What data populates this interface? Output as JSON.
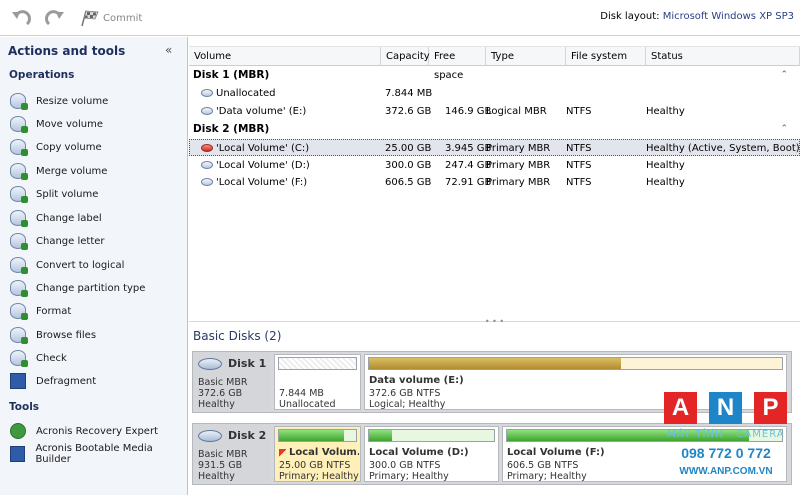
{
  "toolbar": {
    "commit_label": "Commit",
    "disk_layout_label": "Disk layout:",
    "disk_layout_value": "Microsoft Windows XP SP3"
  },
  "sidebar": {
    "title": "Actions and tools",
    "operations_heading": "Operations",
    "operations": [
      "Resize volume",
      "Move volume",
      "Copy volume",
      "Merge volume",
      "Split volume",
      "Change label",
      "Change letter",
      "Convert to logical",
      "Change partition type",
      "Format",
      "Browse files",
      "Check",
      "Defragment"
    ],
    "tools_heading": "Tools",
    "tools": [
      "Acronis Recovery Expert",
      "Acronis Bootable Media Builder"
    ]
  },
  "grid": {
    "columns": [
      "Volume",
      "Capacity",
      "Free space",
      "Type",
      "File system",
      "Status"
    ],
    "groups": [
      {
        "name": "Disk 1 (MBR)",
        "rows": [
          {
            "volume": "Unallocated",
            "capacity": "7.844 MB",
            "free": "",
            "type": "",
            "fs": "",
            "status": ""
          },
          {
            "volume": "'Data volume' (E:)",
            "capacity": "372.6 GB",
            "free": "146.9 GB",
            "type": "Logical MBR",
            "fs": "NTFS",
            "status": "Healthy"
          }
        ]
      },
      {
        "name": "Disk 2 (MBR)",
        "rows": [
          {
            "volume": "'Local Volume' (C:)",
            "capacity": "25.00 GB",
            "free": "3.945 GB",
            "type": "Primary MBR",
            "fs": "NTFS",
            "status": "Healthy (Active, System, Boot)"
          },
          {
            "volume": "'Local Volume' (D:)",
            "capacity": "300.0 GB",
            "free": "247.4 GB",
            "type": "Primary MBR",
            "fs": "NTFS",
            "status": "Healthy"
          },
          {
            "volume": "'Local Volume' (F:)",
            "capacity": "606.5 GB",
            "free": "72.91 GB",
            "type": "Primary MBR",
            "fs": "NTFS",
            "status": "Healthy"
          }
        ]
      }
    ]
  },
  "basic_disks": {
    "title": "Basic Disks (2)",
    "disks": [
      {
        "name": "Disk 1",
        "kind": "Basic MBR",
        "size": "372.6 GB",
        "state": "Healthy",
        "parts": [
          {
            "name": "",
            "line2": "7.844 MB",
            "line3": "Unallocated",
            "used": 0
          },
          {
            "name": "Data volume (E:)",
            "line2": "372.6 GB NTFS",
            "line3": "Logical; Healthy",
            "used": 0.61
          }
        ]
      },
      {
        "name": "Disk 2",
        "kind": "Basic MBR",
        "size": "931.5 GB",
        "state": "Healthy",
        "parts": [
          {
            "name": "Local Volum...",
            "line2": "25.00 GB NTFS",
            "line3": "Primary; Healthy",
            "used": 0.84
          },
          {
            "name": "Local Volume (D:)",
            "line2": "300.0 GB NTFS",
            "line3": "Primary; Healthy",
            "used": 0.18
          },
          {
            "name": "Local Volume (F:)",
            "line2": "606.5 GB NTFS",
            "line3": "Primary; Healthy",
            "used": 0.88
          }
        ]
      }
    ]
  },
  "watermark": {
    "letters": [
      "A",
      "N",
      "P"
    ],
    "tagline": "MÁY TÍNH - CAMERA",
    "phone": "098 772 0 772",
    "web": "WWW.ANP.COM.VN"
  },
  "colors": {
    "accent": "#2a3f86",
    "logical_fill": "#c9a64a",
    "primary_fill": "#5fc24a",
    "wm_red": "#e32526"
  }
}
